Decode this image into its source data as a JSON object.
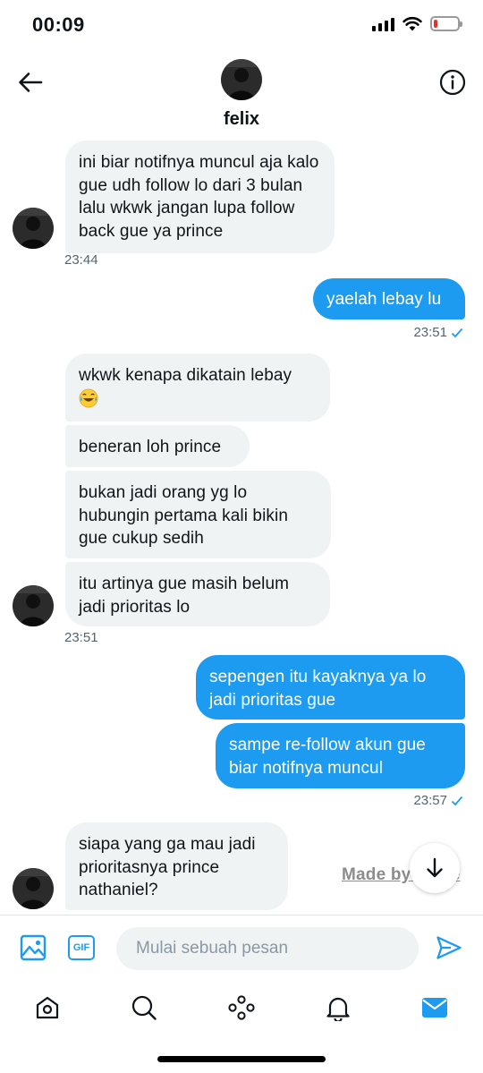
{
  "status_bar": {
    "time": "00:09"
  },
  "header": {
    "name": "felix"
  },
  "messages": {
    "m1": "ini biar notifnya muncul aja kalo gue udh follow lo dari 3 bulan lalu wkwk jangan lupa follow back gue ya prince",
    "t1": "23:44",
    "m2": "yaelah lebay lu",
    "t2": "23:51",
    "m3": "wkwk kenapa dikatain lebay",
    "m4": "beneran loh prince",
    "m5": "bukan jadi orang yg lo hubungin pertama kali bikin gue cukup sedih",
    "m6": "itu artinya gue masih belum jadi prioritas lo",
    "t3": "23:51",
    "m7": "sepengen itu kayaknya ya lo jadi prioritas gue",
    "m8": "sampe re-follow akun gue biar notifnya muncul",
    "t4": "23:57",
    "m9": "siapa yang ga mau jadi prioritasnya prince nathaniel?"
  },
  "watermark": "Made by iFake",
  "composer": {
    "placeholder": "Mulai sebuah pesan",
    "gif_label": "GIF"
  },
  "icons": {
    "back": "arrow-left-icon",
    "info": "info-icon",
    "media": "image-icon",
    "gif": "gif-icon",
    "send": "send-icon",
    "scroll": "arrow-down-icon",
    "tabs": [
      "home-icon",
      "search-icon",
      "spaces-icon",
      "bell-icon",
      "mail-icon"
    ]
  },
  "colors": {
    "accent": "#1d9bf0",
    "bubble_in": "#eff3f4",
    "text": "#0f1419",
    "muted": "#536471"
  }
}
